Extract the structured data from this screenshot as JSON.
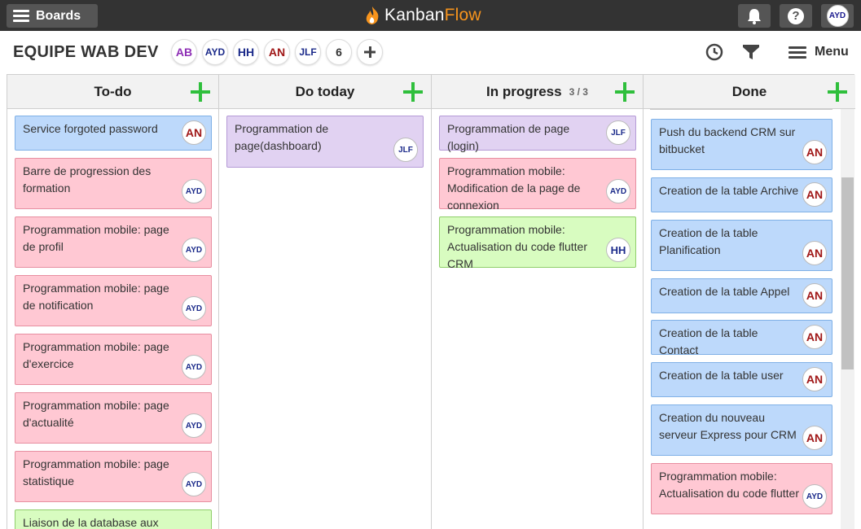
{
  "topbar": {
    "boards_label": "Boards",
    "logo_left": "Kanban",
    "logo_right": "Flow",
    "account_initials": "AYD"
  },
  "board": {
    "title": "EQUIPE WAB DEV",
    "members": [
      {
        "initials": "AB",
        "color": "#8e2fb5"
      },
      {
        "initials": "AYD",
        "color": "#1b2a8a"
      },
      {
        "initials": "HH",
        "color": "#1b2a8a"
      },
      {
        "initials": "AN",
        "color": "#a01818"
      },
      {
        "initials": "JLF",
        "color": "#1b2a8a"
      },
      {
        "initials": "6",
        "color": "#333333"
      }
    ],
    "menu_label": "Menu"
  },
  "colors": {
    "blue": "#bdd9fb",
    "pink": "#ffc8d3",
    "lavender": "#e1d2f2",
    "green": "#d8fcc0",
    "add": "#2fbf3c",
    "topbar": "#333333"
  },
  "columns": [
    {
      "name": "To-do",
      "wip": "",
      "tasks": [
        {
          "text": "Service forgoted password",
          "color": "blue",
          "avatar": "AN"
        },
        {
          "text": "Barre de progression des formation",
          "color": "pink",
          "avatar": "AYD"
        },
        {
          "text": "Programmation mobile: page de profil",
          "color": "pink",
          "avatar": "AYD"
        },
        {
          "text": "Programmation mobile: page de notification",
          "color": "pink",
          "avatar": "AYD"
        },
        {
          "text": "Programmation mobile: page d'exercice",
          "color": "pink",
          "avatar": "AYD"
        },
        {
          "text": "Programmation mobile: page d'actualité",
          "color": "pink",
          "avatar": "AYD"
        },
        {
          "text": "Programmation mobile: page statistique",
          "color": "pink",
          "avatar": "AYD"
        },
        {
          "text": "Liaison de la database aux stats",
          "color": "green",
          "avatar": ""
        }
      ]
    },
    {
      "name": "Do today",
      "wip": "",
      "tasks": [
        {
          "text": "Programmation de page(dashboard)",
          "color": "lav",
          "avatar": "JLF"
        }
      ]
    },
    {
      "name": "In progress",
      "wip": "3 / 3",
      "tasks": [
        {
          "text": "Programmation de page (login)",
          "color": "lav",
          "avatar": "JLF"
        },
        {
          "text": "Programmation mobile: Modification de la page de connexion",
          "color": "pink",
          "avatar": "AYD"
        },
        {
          "text": "Programmation mobile: Actualisation du code flutter CRM",
          "color": "green",
          "avatar": "HH"
        }
      ]
    },
    {
      "name": "Done",
      "wip": "",
      "tasks": [
        {
          "text": "Push du backend CRM sur bitbucket",
          "color": "blue",
          "avatar": "AN"
        },
        {
          "text": "Creation de la table Archive",
          "color": "blue",
          "avatar": "AN"
        },
        {
          "text": "Creation de la table Planification",
          "color": "blue",
          "avatar": "AN"
        },
        {
          "text": "Creation de la table Appel",
          "color": "blue",
          "avatar": "AN"
        },
        {
          "text": "Creation de la table Contact",
          "color": "blue",
          "avatar": "AN"
        },
        {
          "text": "Creation de la table user",
          "color": "blue",
          "avatar": "AN"
        },
        {
          "text": "Creation du nouveau serveur Express pour CRM",
          "color": "blue",
          "avatar": "AN"
        },
        {
          "text": "Programmation mobile: Actualisation du code flutter",
          "color": "pink",
          "avatar": "AYD"
        }
      ]
    }
  ]
}
